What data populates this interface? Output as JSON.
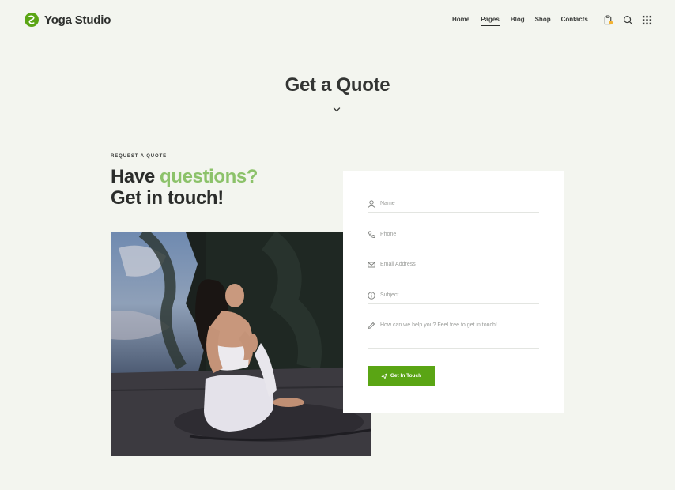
{
  "brand": {
    "name": "Yoga Studio",
    "logo_color": "#5aa514"
  },
  "nav": {
    "items": [
      {
        "label": "Home"
      },
      {
        "label": "Pages",
        "active": true
      },
      {
        "label": "Blog"
      },
      {
        "label": "Shop"
      },
      {
        "label": "Contacts"
      }
    ],
    "icons": [
      "clipboard-icon",
      "search-icon",
      "grid-menu-icon"
    ],
    "cart_badge_color": "#f2b233"
  },
  "page": {
    "title": "Get a Quote"
  },
  "intro": {
    "eyebrow": "REQUEST A QUOTE",
    "headline_part1": "Have ",
    "headline_accent": "questions?",
    "headline_line2": "Get in touch!",
    "accent_color": "#8cc26a"
  },
  "form": {
    "name_placeholder": "Name",
    "phone_placeholder": "Phone",
    "email_placeholder": "Email Address",
    "subject_placeholder": "Subject",
    "message_placeholder": "How can we help you? Feel free to get in touch!",
    "submit_label": "Get In Touch",
    "submit_color": "#5aa514"
  }
}
